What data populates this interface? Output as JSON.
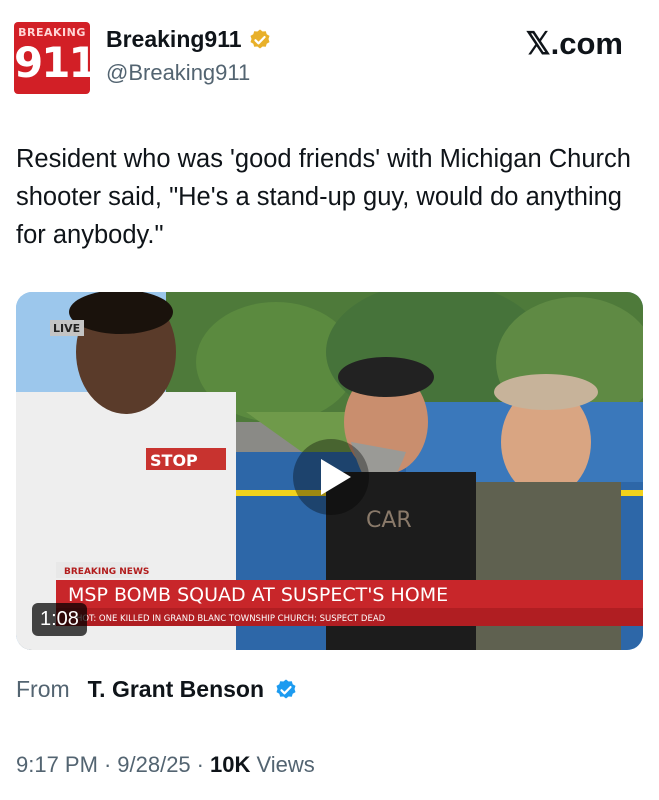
{
  "author": {
    "avatar_top": "BREAKING",
    "avatar_number": "911",
    "display_name": "Breaking911",
    "handle": "@Breaking911",
    "verified_color": "#e8b02a"
  },
  "brand": "𝕏.com",
  "tweet": {
    "text": "Resident who was 'good friends' with Michigan Church shooter said, \"He's a stand-up guy, would do anything for anybody.\""
  },
  "video": {
    "live_badge": "LIVE",
    "stop_sign": "STOP",
    "shirt_text": "CAR",
    "breaking_label": "BREAKING NEWS",
    "headline": "MSP BOMB SQUAD AT SUSPECT'S HOME",
    "ticker": "HOT: ONE KILLED IN GRAND BLANC TOWNSHIP CHURCH; SUSPECT DEAD",
    "duration": "1:08"
  },
  "source": {
    "label": "From",
    "name": "T. Grant Benson",
    "verified_color": "#1d9bf0"
  },
  "meta": {
    "time": "9:17 PM",
    "date": "9/28/25",
    "views_count": "10K",
    "views_label": "Views",
    "separator": "·"
  }
}
